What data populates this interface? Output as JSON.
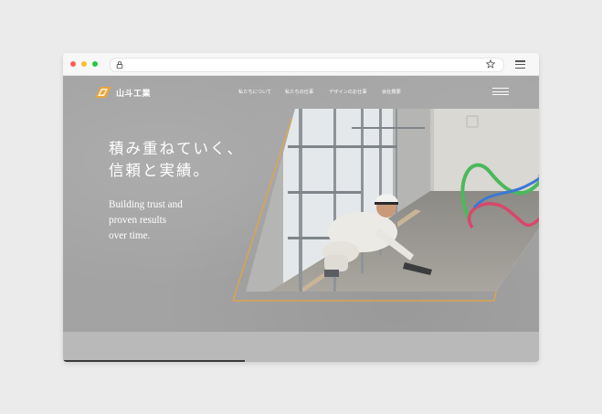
{
  "browser": {
    "icons": {
      "lock": "lock-icon",
      "star": "star-icon",
      "menu": "hamburger-icon"
    }
  },
  "site": {
    "logo_text": "山斗工業",
    "nav": [
      {
        "label": "私たちについて"
      },
      {
        "label": "私たちの仕事"
      },
      {
        "label": "デザインのお仕事"
      },
      {
        "label": "会社概要"
      }
    ],
    "hero": {
      "headline_line1": "積み重ねていく、",
      "headline_line2": "信頼と実績。",
      "tagline_line1": "Building trust and",
      "tagline_line2": "proven results",
      "tagline_line3": "over time."
    }
  },
  "colors": {
    "background": "#ebebeb",
    "site_background": "#a3a3a3",
    "accent_orange": "#e8a53c",
    "traffic_red": "#ff5f57",
    "traffic_yellow": "#febc2e",
    "traffic_green": "#28c840"
  }
}
